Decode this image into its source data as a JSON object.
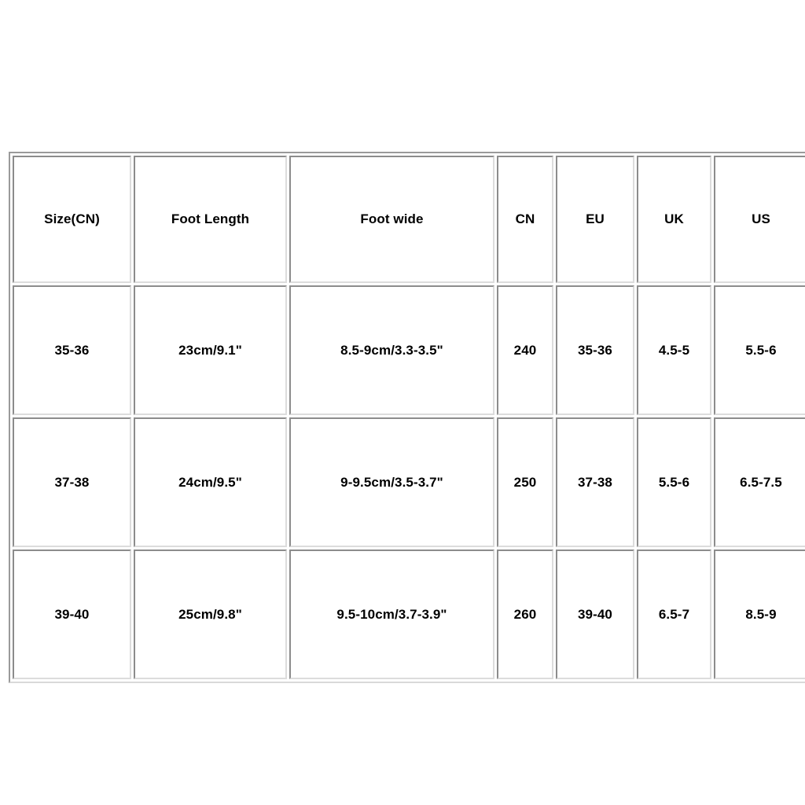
{
  "page": {
    "background_color": "#ffffff",
    "text_color": "#000000",
    "border_dark_color": "#8c8c8c",
    "border_light_color": "#dcdcdc"
  },
  "table": {
    "name": "shoe-size-conversion-chart",
    "columns": [
      {
        "key": "size_cn",
        "label": "Size(CN)"
      },
      {
        "key": "foot_length",
        "label": "Foot Length"
      },
      {
        "key": "foot_wide",
        "label": "Foot wide"
      },
      {
        "key": "cn",
        "label": "CN"
      },
      {
        "key": "eu",
        "label": "EU"
      },
      {
        "key": "uk",
        "label": "UK"
      },
      {
        "key": "us",
        "label": "US"
      }
    ],
    "rows": [
      {
        "size_cn": "35-36",
        "foot_length": "23cm/9.1\"",
        "foot_wide": "8.5-9cm/3.3-3.5\"",
        "cn": "240",
        "eu": "35-36",
        "uk": "4.5-5",
        "us": "5.5-6"
      },
      {
        "size_cn": "37-38",
        "foot_length": "24cm/9.5\"",
        "foot_wide": "9-9.5cm/3.5-3.7\"",
        "cn": "250",
        "eu": "37-38",
        "uk": "5.5-6",
        "us": "6.5-7.5"
      },
      {
        "size_cn": "39-40",
        "foot_length": "25cm/9.8\"",
        "foot_wide": "9.5-10cm/3.7-3.9\"",
        "cn": "260",
        "eu": "39-40",
        "uk": "6.5-7",
        "us": "8.5-9"
      }
    ]
  }
}
